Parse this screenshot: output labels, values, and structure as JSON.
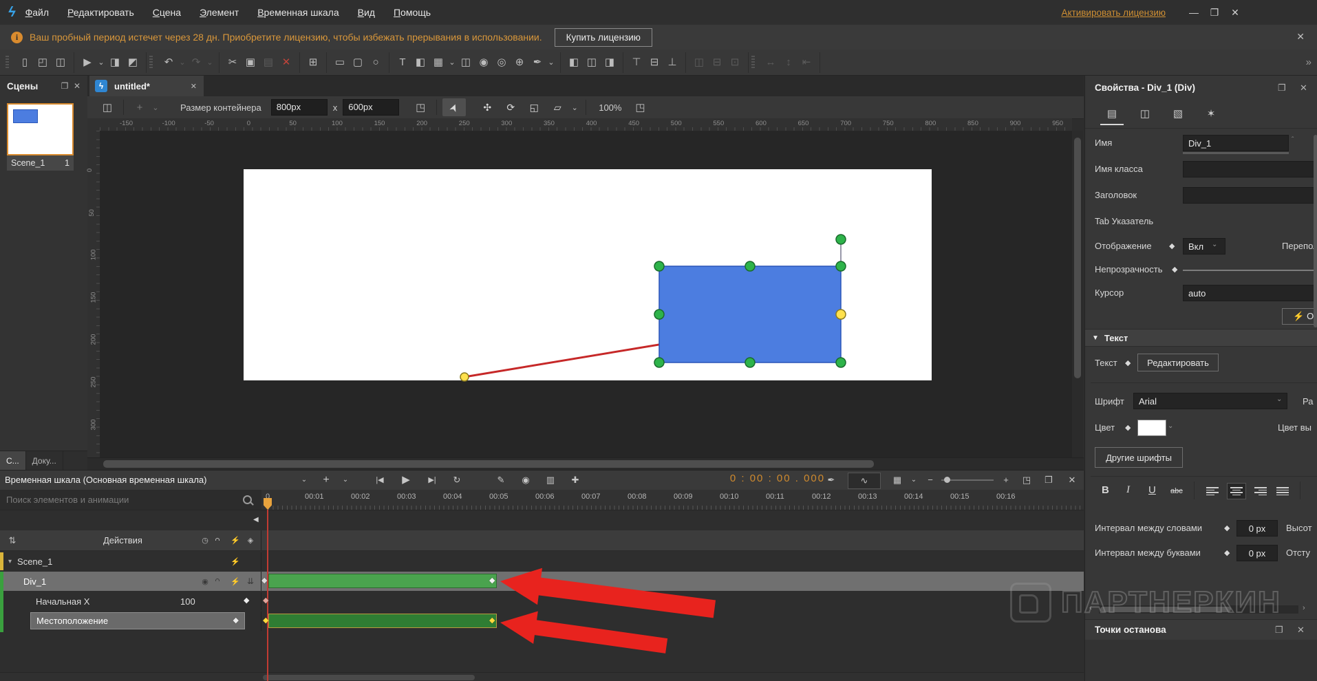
{
  "window": {
    "menus": [
      {
        "label": "Файл"
      },
      {
        "label": "Редактировать"
      },
      {
        "label": "Сцена"
      },
      {
        "label": "Элемент"
      },
      {
        "label": "Временная шкала"
      },
      {
        "label": "Вид"
      },
      {
        "label": "Помощь"
      }
    ],
    "license_link": "Активировать лицензию",
    "minimize": "—",
    "maximize": "❐",
    "close": "✕"
  },
  "trial_bar": {
    "info_glyph": "i",
    "text": "Ваш пробный период истечет через 28 дн. Приобретите лицензию, чтобы избежать прерывания в использовании.",
    "buy_button": "Купить лицензию",
    "close_glyph": "✕"
  },
  "toolbar": {
    "groups": [
      {
        "grip": true,
        "items": [
          {
            "n": "new-file",
            "g": "▯"
          },
          {
            "n": "open-file",
            "g": "◰"
          },
          {
            "n": "save-file",
            "g": "◫"
          }
        ]
      },
      {
        "items": [
          {
            "n": "preview-in-browser",
            "g": "▶"
          },
          {
            "n": "preview-arrow",
            "g": "⌄",
            "sm": 1
          },
          {
            "n": "export",
            "g": "◨"
          },
          {
            "n": "package",
            "g": "◩"
          }
        ]
      },
      {
        "grip": true,
        "items": [
          {
            "n": "undo",
            "g": "↶"
          },
          {
            "n": "undo-arrow",
            "g": "⌄",
            "sm": 1,
            "d": 1
          },
          {
            "n": "redo",
            "g": "↷",
            "d": 1
          },
          {
            "n": "redo-arrow",
            "g": "⌄",
            "sm": 1,
            "d": 1
          }
        ]
      },
      {
        "items": [
          {
            "n": "cut",
            "g": "✂"
          },
          {
            "n": "copy",
            "g": "▣"
          },
          {
            "n": "paste",
            "g": "▤",
            "d": 1
          },
          {
            "n": "delete",
            "g": "✕",
            "r": 1
          }
        ]
      },
      {
        "items": [
          {
            "n": "group",
            "g": "⊞"
          }
        ]
      },
      {
        "items": [
          {
            "n": "rectangle",
            "g": "▭"
          },
          {
            "n": "rounded-rectangle",
            "g": "▢"
          },
          {
            "n": "ellipse",
            "g": "○"
          }
        ]
      },
      {
        "items": [
          {
            "n": "text",
            "g": "T"
          },
          {
            "n": "div",
            "g": "◧"
          },
          {
            "n": "image",
            "g": "▦"
          },
          {
            "n": "image-arrow",
            "g": "⌄",
            "sm": 1
          },
          {
            "n": "video",
            "g": "◫"
          },
          {
            "n": "audio",
            "g": "◉"
          },
          {
            "n": "symbol",
            "g": "◎"
          },
          {
            "n": "embed",
            "g": "⊕"
          },
          {
            "n": "freeform",
            "g": "✒"
          },
          {
            "n": "freeform-arrow",
            "g": "⌄",
            "sm": 1
          }
        ]
      },
      {
        "items": [
          {
            "n": "align-left",
            "g": "◧"
          },
          {
            "n": "align-center",
            "g": "◫"
          },
          {
            "n": "align-right",
            "g": "◨"
          }
        ]
      },
      {
        "items": [
          {
            "n": "align-top",
            "g": "⊤"
          },
          {
            "n": "align-middle",
            "g": "⊟"
          },
          {
            "n": "align-bottom",
            "g": "⊥"
          }
        ]
      },
      {
        "items": [
          {
            "n": "distribute-horizontal",
            "g": "◫",
            "d": 1
          },
          {
            "n": "distribute-vertical",
            "g": "⊟",
            "d": 1
          },
          {
            "n": "match-size",
            "g": "⊡",
            "d": 1
          }
        ]
      },
      {
        "grip": true,
        "items": [
          {
            "n": "space-horizontal",
            "g": "↔",
            "d": 1
          },
          {
            "n": "space-vertical",
            "g": "↕",
            "d": 1
          },
          {
            "n": "same-size",
            "g": "⇤",
            "d": 1
          }
        ]
      }
    ],
    "overflow_glyph": "»"
  },
  "scenes_panel": {
    "title": "Сцены",
    "popout_glyph": "❐",
    "close_glyph": "✕",
    "scene_name": "Scene_1",
    "scene_count": "1",
    "bottom_tabs": [
      {
        "label": "С...",
        "active": true
      },
      {
        "label": "Доку...",
        "active": false
      }
    ]
  },
  "document": {
    "tab_title": "untitled*",
    "tab_icon_glyph": "ϟ",
    "tab_close": "✕"
  },
  "stage_toolbar": {
    "container_size_label": "Размер контейнера",
    "width_value": "800px",
    "times_label": "x",
    "height_value": "600px",
    "zoom_value": "100%",
    "plus_glyph": "+",
    "chevron": "⌄"
  },
  "stage": {
    "h_ruler_ticks": [
      "-150",
      "-100",
      "-50",
      "0",
      "50",
      "100",
      "150",
      "200",
      "250",
      "300",
      "350",
      "400",
      "450",
      "500",
      "550",
      "600",
      "650",
      "700",
      "750",
      "800",
      "850",
      "900",
      "950"
    ],
    "v_ruler_ticks": [
      "0",
      "50",
      "100",
      "150",
      "200",
      "250",
      "300"
    ],
    "element_fill": "#4c7de0",
    "element_stroke": "#2a55b8",
    "handle_green": "#2eb34a",
    "handle_yellow": "#ffe14d",
    "path_red": "#c62828"
  },
  "properties_panel": {
    "title": "Свойства - Div_1 (Div)",
    "popout_glyph": "❐",
    "close_glyph": "✕",
    "tabs": [
      {
        "n": "tab-general",
        "g": "▤"
      },
      {
        "n": "tab-position-size",
        "g": "◫"
      },
      {
        "n": "tab-styles",
        "g": "▧"
      },
      {
        "n": "tab-effects",
        "g": "✶"
      }
    ],
    "name_label": "Имя",
    "name_value": "Div_1",
    "class_label": "Имя класса",
    "title_label": "Заголовок",
    "tabindex_label": "Tab Указатель",
    "display_label": "Отображение",
    "display_value": "Вкл",
    "overflow_label_cut": "Перепол",
    "opacity_label": "Непрозрачность",
    "cursor_label": "Курсор",
    "cursor_value": "auto",
    "events_button_cut": "⚡ Об",
    "text_section": "Текст",
    "text_label": "Текст",
    "edit_button": "Редактировать",
    "font_label": "Шрифт",
    "font_value": "Arial",
    "size_label_cut": "Ра",
    "color_label": "Цвет",
    "selection_color_label_cut": "Цвет вы",
    "more_fonts_button": "Другие шрифты",
    "bold": "B",
    "italic": "I",
    "underline": "U",
    "strike": "abc",
    "word_spacing_label": "Интервал между словами",
    "word_spacing_value": "0 px",
    "height_label_cut": "Высот",
    "letter_spacing_label": "Интервал между буквами",
    "letter_spacing_value": "0 px",
    "indent_label_cut": "Отсту",
    "diamond_glyph": "◆",
    "chevron": "⌄"
  },
  "breakpoints_panel": {
    "title": "Точки останова",
    "popout_glyph": "❐",
    "close_glyph": "✕"
  },
  "timeline": {
    "title": "Временная шкала (Основная временная шкала)",
    "plus_glyph": "+",
    "chevron": "⌄",
    "transport": {
      "prev": "|◀",
      "play": "▶",
      "next": "▶|",
      "loop": "↻"
    },
    "mode_icons": {
      "auto_key": "✎",
      "record": "◉",
      "filter": "▥",
      "add_keyframe": "✚"
    },
    "time_display": "0 : 00 : 00 . 000",
    "right_icons": {
      "pen": "✒",
      "snap": "∿",
      "grid": "▦",
      "grid_chevron": "⌄",
      "zoom_out": "−",
      "zoom_in": "+",
      "expand": "◳",
      "popout": "❐",
      "close": "✕"
    },
    "search_placeholder": "Поиск элементов и анимации",
    "ruler_zero": "0",
    "ruler_ticks": [
      "00:01",
      "00:02",
      "00:03",
      "00:04",
      "00:05",
      "00:06",
      "00:07",
      "00:08",
      "00:09",
      "00:10",
      "00:11",
      "00:12",
      "00:13",
      "00:14",
      "00:15",
      "00:16"
    ],
    "actions_header": "Действия",
    "header_icons": {
      "sort": "⇅",
      "history": "◷",
      "bolt": "⚡",
      "keyframe": "◈"
    },
    "tracks": {
      "scene": {
        "name": "Scene_1",
        "collapse": "▾",
        "bolt": "⚡"
      },
      "div": {
        "name": "Div_1",
        "eye": "◉",
        "bolt": "⚡",
        "collapse": "⇊"
      },
      "initial_x": {
        "name": "Начальная X",
        "value": "100"
      },
      "location": {
        "name": "Местоположение"
      }
    },
    "colors": {
      "bar_green": "#4aa34e",
      "bar_dark_green": "#2f7d33",
      "bar_border_olive": "#b89b3e",
      "keyframe_yellow": "#ffd93b",
      "keyframe_white": "#f2f2f2",
      "strip_yellow": "#d9b43a",
      "strip_green": "#3aa03e",
      "playhead_red": "#c23b33",
      "arrow_red": "#e8231e",
      "selected_row": "#707070",
      "time_orange": "#cf8a2e"
    }
  },
  "watermark": {
    "text": "ПАРТНЕРКИН"
  }
}
